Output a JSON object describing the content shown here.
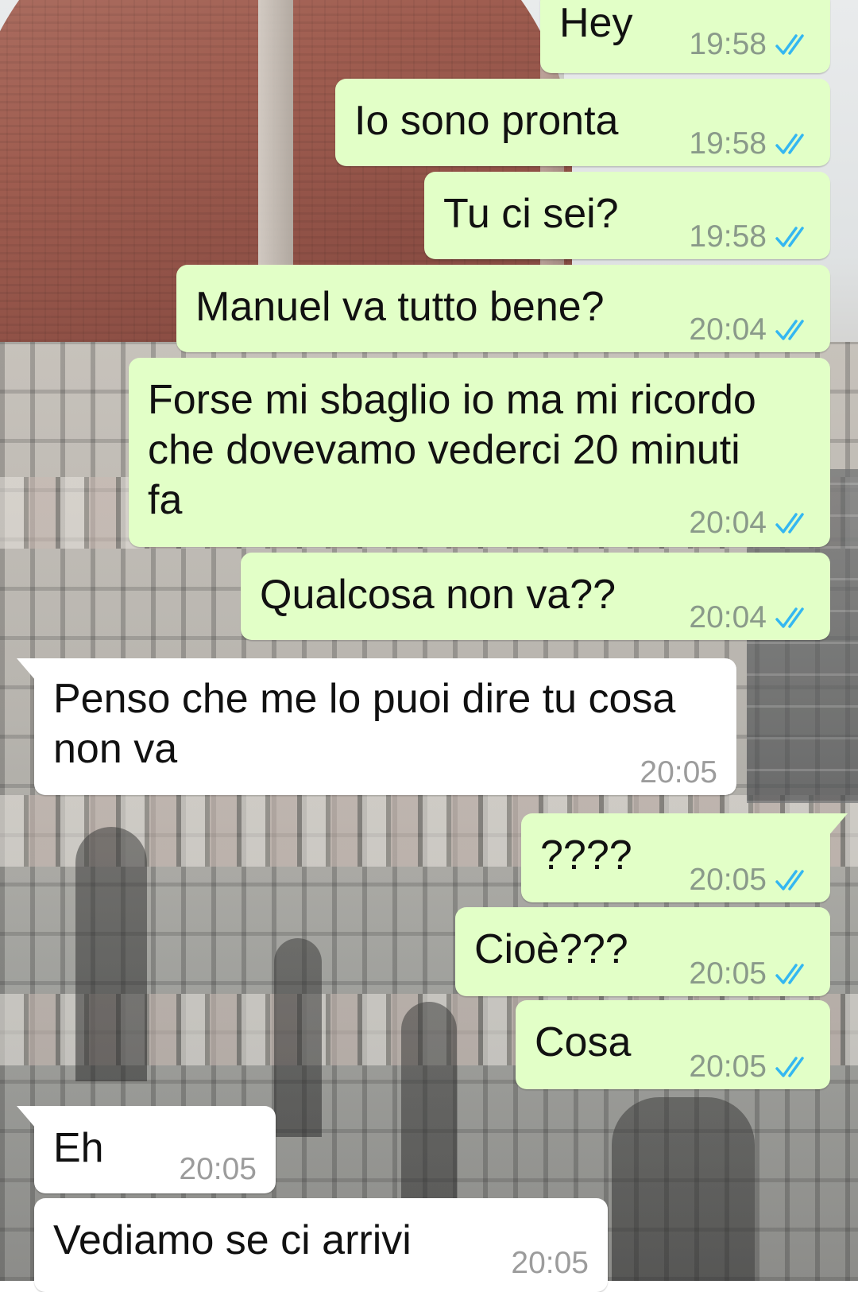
{
  "chat": {
    "messages": [
      {
        "direction": "out",
        "text": "Hey",
        "time": "19:58",
        "status": "read-double-tick-icon"
      },
      {
        "direction": "out",
        "text": "Io sono pronta",
        "time": "19:58",
        "status": "read-double-tick-icon"
      },
      {
        "direction": "out",
        "text": "Tu ci sei?",
        "time": "19:58",
        "status": "read-double-tick-icon"
      },
      {
        "direction": "out",
        "text": "Manuel va tutto bene?",
        "time": "20:04",
        "status": "read-double-tick-icon"
      },
      {
        "direction": "out",
        "text": "Forse mi sbaglio io ma mi ricordo\nche dovevamo vederci 20 minuti\nfa",
        "time": "20:04",
        "status": "read-double-tick-icon"
      },
      {
        "direction": "out",
        "text": "Qualcosa non va??",
        "time": "20:04",
        "status": "read-double-tick-icon"
      },
      {
        "direction": "in",
        "text": "Penso che me lo puoi dire tu cosa\nnon va",
        "time": "20:05"
      },
      {
        "direction": "out",
        "text": "????",
        "time": "20:05",
        "status": "read-double-tick-icon"
      },
      {
        "direction": "out",
        "text": "Cioè???",
        "time": "20:05",
        "status": "read-double-tick-icon"
      },
      {
        "direction": "out",
        "text": "Cosa",
        "time": "20:05",
        "status": "read-double-tick-icon"
      },
      {
        "direction": "in",
        "text": "Eh",
        "time": "20:05"
      },
      {
        "direction": "in",
        "text": "Vediamo se ci arrivi",
        "time": "20:05"
      }
    ]
  },
  "colors": {
    "outgoing_bubble": "#e2ffc7",
    "incoming_bubble": "#ffffff",
    "read_tick": "#34b7f1"
  }
}
